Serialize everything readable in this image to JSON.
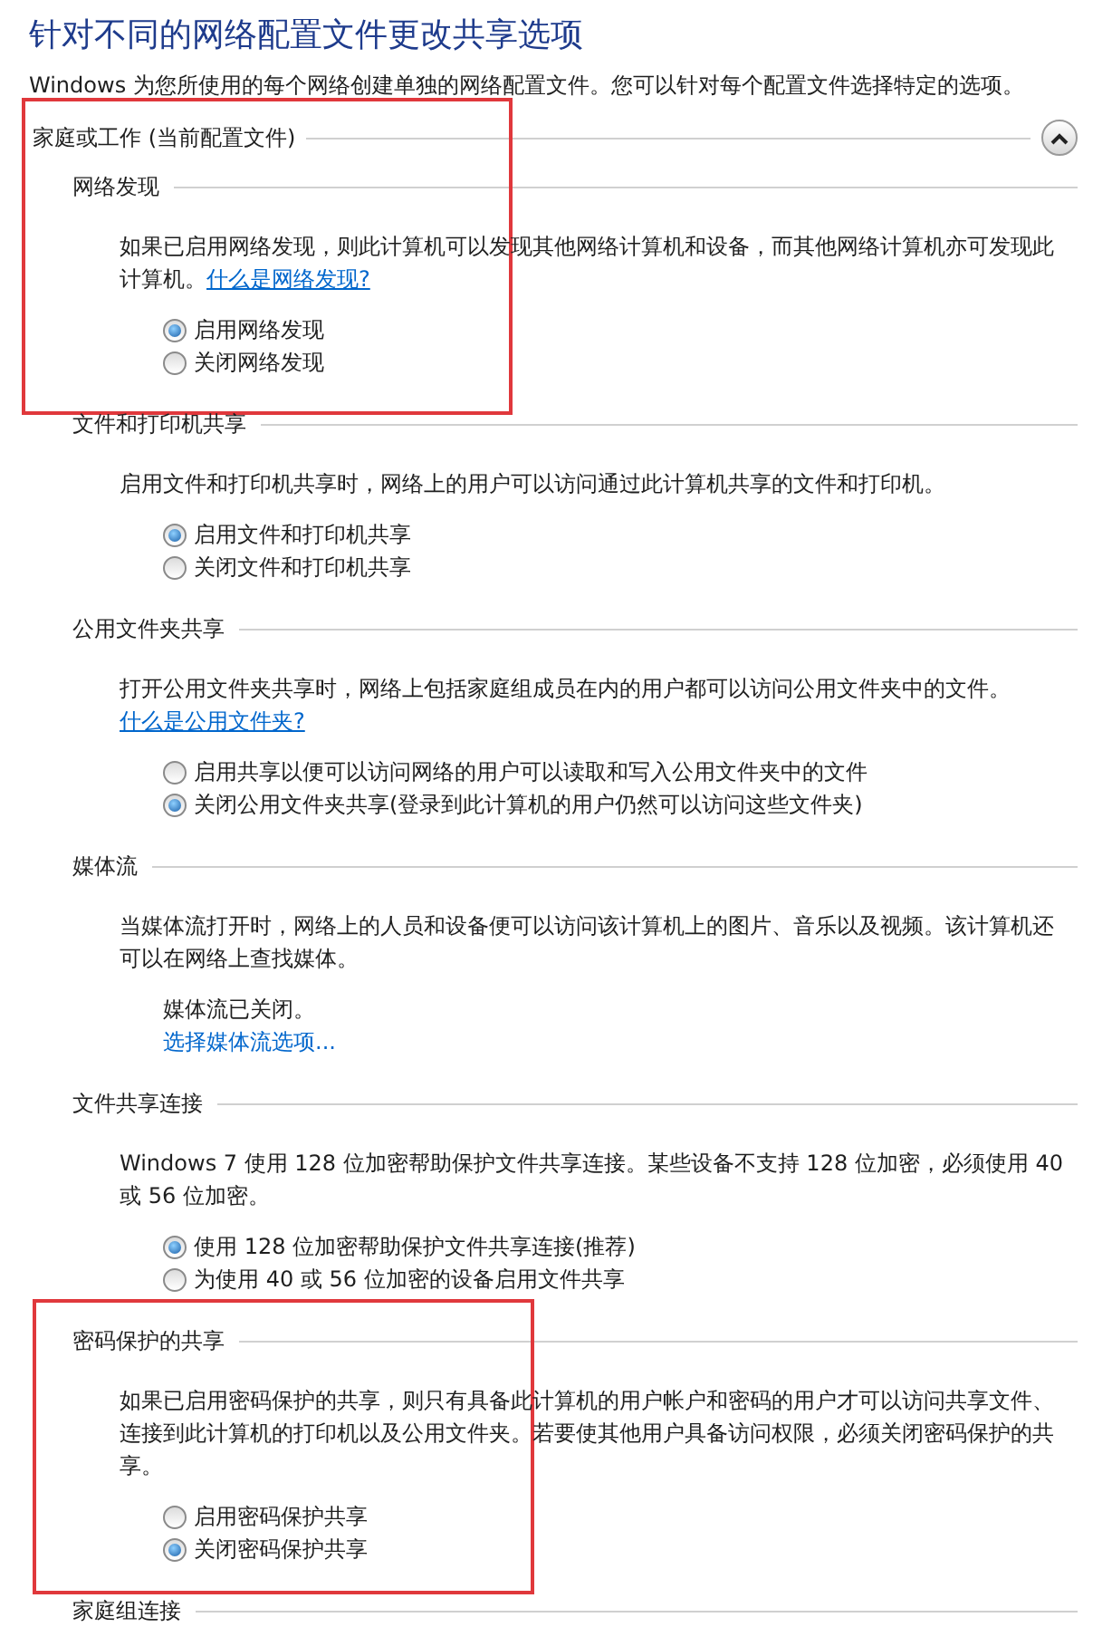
{
  "title": "针对不同的网络配置文件更改共享选项",
  "subtitle": "Windows 为您所使用的每个网络创建单独的网络配置文件。您可以针对每个配置文件选择特定的选项。",
  "profile": {
    "label": "家庭或工作 (当前配置文件)",
    "expanded": true
  },
  "sections": [
    {
      "label": "网络发现",
      "highlighted": true,
      "description": "如果已启用网络发现，则此计算机可以发现其他网络计算机和设备，而其他网络计算机亦可发现此计算机。",
      "link": "什么是网络发现?",
      "items": [
        {
          "kind": "radio",
          "label": "启用网络发现",
          "selected": true
        },
        {
          "kind": "radio",
          "label": "关闭网络发现",
          "selected": false
        }
      ]
    },
    {
      "label": "文件和打印机共享",
      "highlighted": false,
      "description": "启用文件和打印机共享时，网络上的用户可以访问通过此计算机共享的文件和打印机。",
      "items": [
        {
          "kind": "radio",
          "label": "启用文件和打印机共享",
          "selected": true
        },
        {
          "kind": "radio",
          "label": "关闭文件和打印机共享",
          "selected": false
        }
      ]
    },
    {
      "label": "公用文件夹共享",
      "highlighted": false,
      "description": "打开公用文件夹共享时，网络上包括家庭组成员在内的用户都可以访问公用文件夹中的文件。",
      "link": "什么是公用文件夹?",
      "items": [
        {
          "kind": "radio",
          "label": "启用共享以便可以访问网络的用户可以读取和写入公用文件夹中的文件",
          "selected": false
        },
        {
          "kind": "radio",
          "label": "关闭公用文件夹共享(登录到此计算机的用户仍然可以访问这些文件夹)",
          "selected": true
        }
      ]
    },
    {
      "label": "媒体流",
      "highlighted": false,
      "description": "当媒体流打开时，网络上的人员和设备便可以访问该计算机上的图片、音乐以及视频。该计算机还可以在网络上查找媒体。",
      "items": [
        {
          "kind": "text",
          "label": "媒体流已关闭。"
        },
        {
          "kind": "link",
          "label": "选择媒体流选项..."
        }
      ]
    },
    {
      "label": "文件共享连接",
      "highlighted": false,
      "description": "Windows 7 使用 128 位加密帮助保护文件共享连接。某些设备不支持 128 位加密，必须使用 40 或 56 位加密。",
      "items": [
        {
          "kind": "radio",
          "label": "使用 128 位加密帮助保护文件共享连接(推荐)",
          "selected": true
        },
        {
          "kind": "radio",
          "label": "为使用 40 或 56 位加密的设备启用文件共享",
          "selected": false
        }
      ]
    },
    {
      "label": "密码保护的共享",
      "highlighted": true,
      "description": "如果已启用密码保护的共享，则只有具备此计算机的用户帐户和密码的用户才可以访问共享文件、连接到此计算机的打印机以及公用文件夹。若要使其他用户具备访问权限，必须关闭密码保护的共享。",
      "items": [
        {
          "kind": "radio",
          "label": "启用密码保护共享",
          "selected": false
        },
        {
          "kind": "radio",
          "label": "关闭密码保护共享",
          "selected": true
        }
      ]
    },
    {
      "label": "家庭组连接",
      "highlighted": false
    }
  ]
}
